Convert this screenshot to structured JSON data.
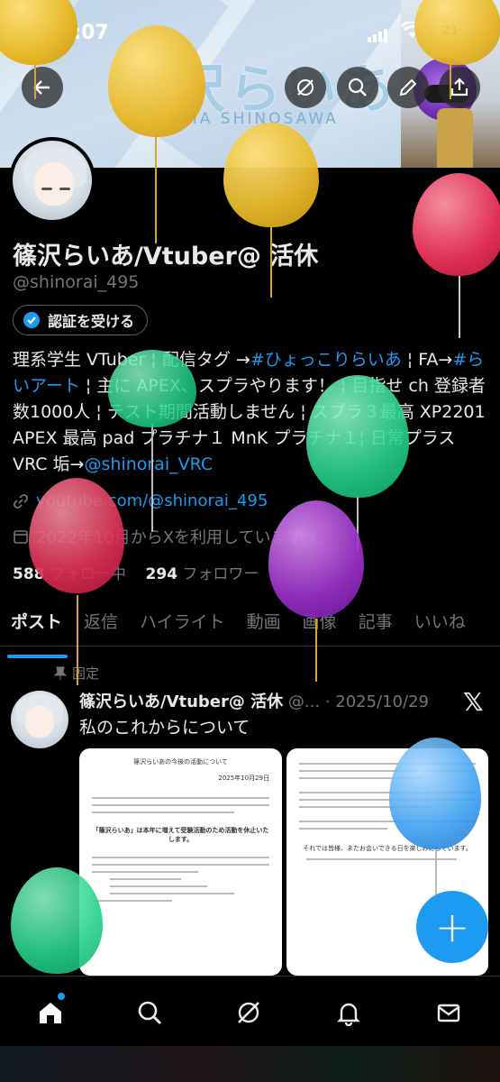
{
  "status_bar": {
    "time": "0:07",
    "battery": "21"
  },
  "banner": {
    "logo_text": "篠沢らいあ",
    "sub_text": "RAIA SHINOSAWA"
  },
  "top_buttons": [
    "back-icon",
    "grok-icon",
    "search-icon",
    "edit-icon",
    "share-icon"
  ],
  "profile": {
    "display_name": "篠沢らいあ/Vtuber@ 活休",
    "handle": "@shinorai_495",
    "verify_button": "認証を受ける",
    "bio": {
      "t1": "理系学生 VTuber ¦ 配信タグ →",
      "tag1": "#ひょっこりらいあ",
      "t2": " ¦ FA→",
      "tag2": "#らいアート",
      "t3": " ¦ 主に APEX、スプラやります！ ¦ 目指せ ch 登録者数1000人 ¦ テスト期間活動しません ¦ スプラ３最高 XP2201 APEX 最高 pad プラチナ１ MnK プラチナ１¦ 日常プラス VRC 垢→",
      "mention": "@shinorai_VRC"
    },
    "website": "youtube.com/@shinorai_495",
    "joined": "2022年10月からXを利用しています",
    "following_count": "588",
    "following_label": "フォロー中",
    "followers_count": "294",
    "followers_label": "フォロワー"
  },
  "tabs": [
    "ポスト",
    "返信",
    "ハイライト",
    "動画",
    "画像",
    "記事",
    "いいね"
  ],
  "pinned_label": "固定",
  "post": {
    "author": "篠沢らいあ/Vtuber@ 活休",
    "handle_date": "@... · 2025/10/29",
    "text": "私のこれからについて",
    "doc1_title": "篠沢らいあの今後の活動について",
    "doc1_date": "2025年10月29日",
    "doc1_heading": "「篠沢らいあ」は本年に増えて受験活動のため活動を休止いたします。",
    "doc2_text": "それでは皆様、またお会いできる日を楽しみにしています。"
  },
  "fab_label": "+",
  "bottom_nav": [
    "home-icon",
    "search-icon",
    "grok-icon",
    "notifications-icon",
    "messages-icon"
  ],
  "colors": {
    "accent": "#1d9bf0",
    "background": "#000000",
    "muted": "#71767b"
  }
}
